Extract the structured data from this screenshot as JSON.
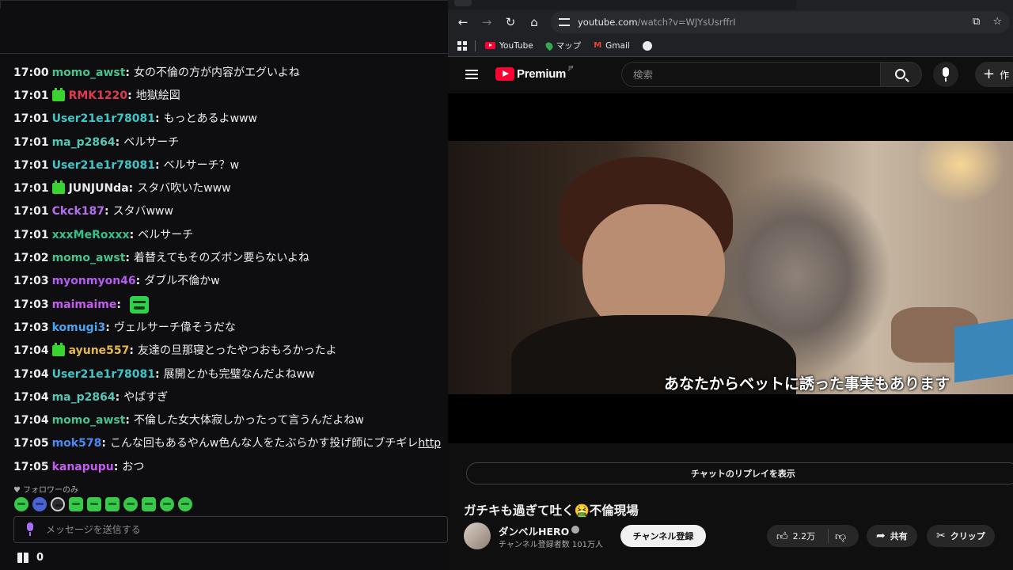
{
  "chat": {
    "messages": [
      {
        "time": "17:00",
        "badge": false,
        "user": "momo_awst",
        "color": "#49c28d",
        "text": "女の不倫の方が内容がエグいよね",
        "emote": false
      },
      {
        "time": "17:01",
        "badge": true,
        "user": "RMK1220",
        "color": "#e03a4f",
        "text": "地獄絵図",
        "emote": false
      },
      {
        "time": "17:01",
        "badge": false,
        "user": "User21e1r78081",
        "color": "#3fc6c9",
        "text": "もっとあるよwww",
        "emote": false
      },
      {
        "time": "17:01",
        "badge": false,
        "user": "ma_p2864",
        "color": "#56c6b6",
        "text": "ベルサーチ",
        "emote": false
      },
      {
        "time": "17:01",
        "badge": false,
        "user": "User21e1r78081",
        "color": "#3fc6c9",
        "text": "ベルサーチ？w",
        "emote": false
      },
      {
        "time": "17:01",
        "badge": true,
        "user": "JUNJUNda",
        "color": "#e8e8ea",
        "text": "スタバ吹いたwww",
        "emote": false
      },
      {
        "time": "17:01",
        "badge": false,
        "user": "Ckck187",
        "color": "#b66df0",
        "text": "スタバwww",
        "emote": false
      },
      {
        "time": "17:01",
        "badge": false,
        "user": "xxxMeRoxxx",
        "color": "#35c08a",
        "text": "ベルサーチ",
        "emote": false
      },
      {
        "time": "17:02",
        "badge": false,
        "user": "momo_awst",
        "color": "#49c28d",
        "text": "着替えてもそのズボン要らないよね",
        "emote": false
      },
      {
        "time": "17:03",
        "badge": false,
        "user": "myonmyon46",
        "color": "#b45cf0",
        "text": "ダブル不倫かw",
        "emote": false
      },
      {
        "time": "17:03",
        "badge": false,
        "user": "maimaime",
        "color": "#c65cf2",
        "text": "",
        "emote": true
      },
      {
        "time": "17:03",
        "badge": false,
        "user": "komugi3",
        "color": "#4aa5f0",
        "text": "ヴェルサーチ偉そうだな",
        "emote": false
      },
      {
        "time": "17:04",
        "badge": true,
        "user": "ayune557",
        "color": "#e6b84a",
        "text": "友達の旦那寝とったやつおもろかったよ",
        "emote": false
      },
      {
        "time": "17:04",
        "badge": false,
        "user": "User21e1r78081",
        "color": "#3fc6c9",
        "text": "展開とかも完璧なんだよねww",
        "emote": false
      },
      {
        "time": "17:04",
        "badge": false,
        "user": "ma_p2864",
        "color": "#56c6b6",
        "text": "やばすぎ",
        "emote": false
      },
      {
        "time": "17:04",
        "badge": false,
        "user": "momo_awst",
        "color": "#49c28d",
        "text": "不倫した女大体寂しかったって言うんだよねw",
        "emote": false
      },
      {
        "time": "17:05",
        "badge": false,
        "user": "mok578",
        "color": "#4a8af5",
        "text": "こんな回もあるやんw色んな人をたぶらかす投げ師にブチギレ",
        "link": "http",
        "emote": false
      },
      {
        "time": "17:05",
        "badge": false,
        "user": "kanapupu",
        "color": "#c65cf2",
        "text": "おつ",
        "emote": false
      }
    ],
    "follower_note": "フォロワーのみ",
    "input_placeholder": "メッセージを送信する",
    "points": "0"
  },
  "browser": {
    "url_host": "youtube.com",
    "url_path": "/watch?v=WJYsUsrffrI",
    "bookmarks": [
      {
        "label": "YouTube",
        "icon": "youtube-icon"
      },
      {
        "label": "マップ",
        "icon": "maps-pin-icon"
      },
      {
        "label": "Gmail",
        "icon": "gmail-icon"
      }
    ]
  },
  "youtube": {
    "logo_text": "Premium",
    "logo_region": "JP",
    "search_placeholder": "検索",
    "create_label": "作",
    "subtitle": "あなたからベットに誘った事実もあります",
    "chat_replay_label": "チャットのリプレイを表示",
    "video_title": "ガチキも過ぎて吐く🤮不倫現場",
    "channel_name": "ダンベルHERO",
    "subscribers": "チャンネル登録者数 101万人",
    "subscribe_label": "チャンネル登録",
    "likes": "2.2万",
    "share_label": "共有",
    "clip_label": "クリップ"
  }
}
